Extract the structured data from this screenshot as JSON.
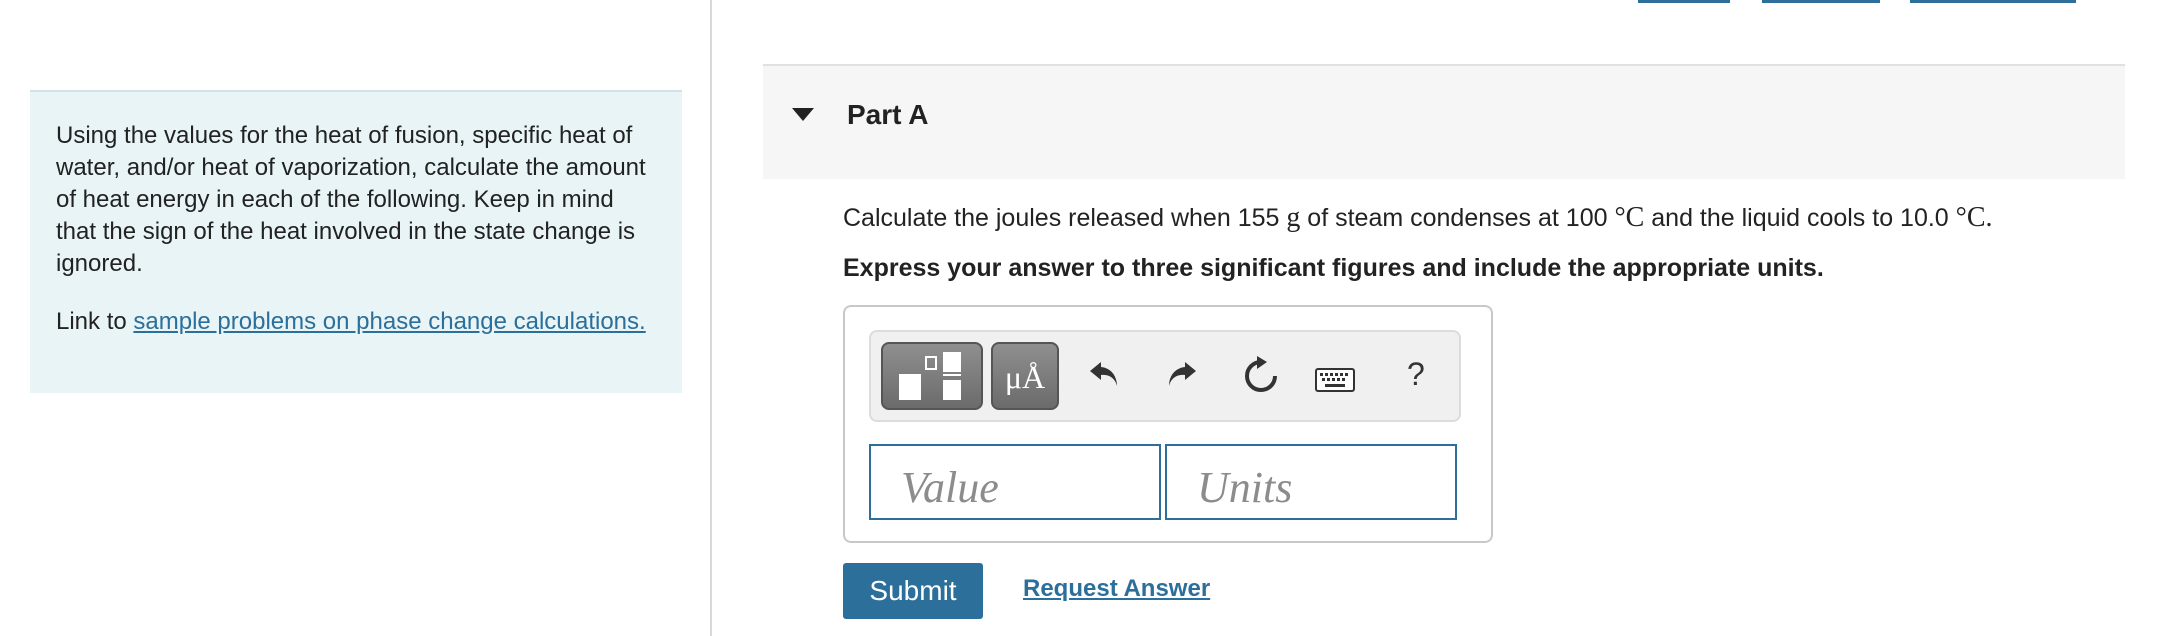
{
  "info_panel": {
    "description": "Using the values for the heat of fusion, specific heat of water, and/or heat of vaporization, calculate the amount of heat energy in each of the following. Keep in mind that the sign of the heat involved in the state change is ignored.",
    "link_prefix": "Link to ",
    "link_text": "sample problems on phase change calculations."
  },
  "part": {
    "title": "Part A",
    "question_pre": "Calculate the joules released when 155 ",
    "question_g": "g",
    "question_mid": " of steam condenses at 100 ",
    "question_unit1": "°C",
    "question_mid2": " and the liquid cools to 10.0 ",
    "question_unit2": "°C.",
    "instruction": "Express your answer to three significant figures and include the appropriate units."
  },
  "toolbar": {
    "units_button_label": "μÅ",
    "help_label": "?",
    "icons": [
      "templates-icon",
      "units-icon",
      "undo-icon",
      "redo-icon",
      "reset-icon",
      "keyboard-icon",
      "help-icon"
    ]
  },
  "answer": {
    "value_placeholder": "Value",
    "units_placeholder": "Units"
  },
  "actions": {
    "submit_label": "Submit",
    "request_label": "Request Answer"
  },
  "colors": {
    "accent": "#2b6f9a",
    "info_bg": "#e8f4f6",
    "header_bg": "#f6f6f6"
  }
}
